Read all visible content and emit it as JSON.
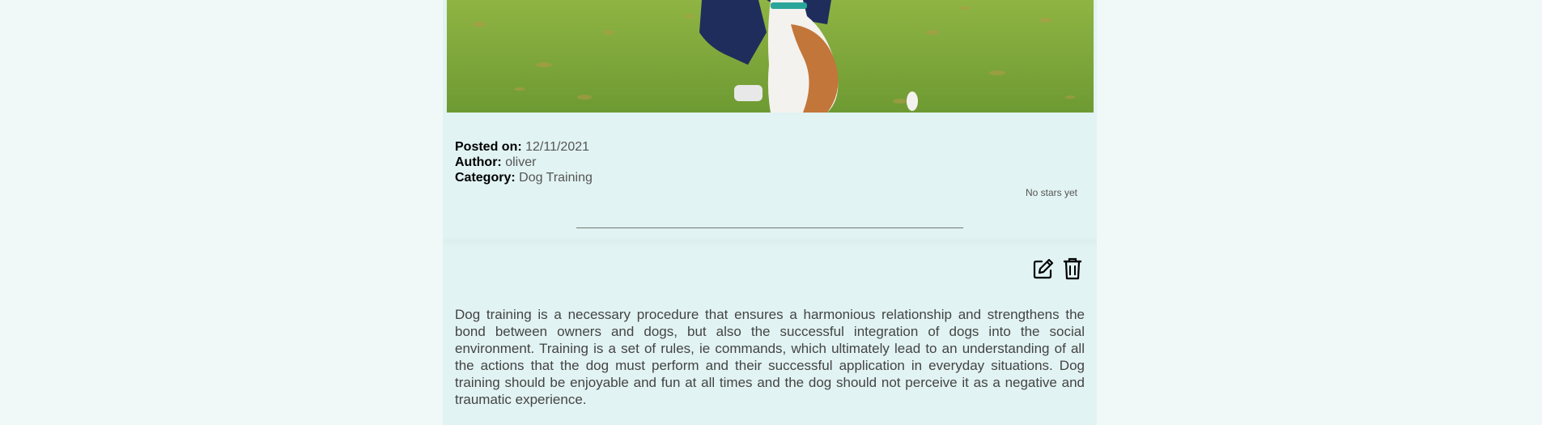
{
  "post": {
    "hero_alt": "Person kneeling on grass with a brown and white dog",
    "posted_on_label": "Posted on:",
    "posted_on_value": "12/11/2021",
    "author_label": "Author:",
    "author_value": "oliver",
    "category_label": "Category:",
    "category_value": "Dog Training",
    "rating_text": "No stars yet",
    "body": "Dog training is a necessary procedure that ensures a harmonious relationship and strengthens the bond between owners and dogs, but also the successful integration of dogs into the social environment. Training is a set of rules, ie commands, which ultimately lead to an understanding of all the actions that the dog must perform and their successful application in everyday situations. Dog training should be enjoyable and fun at all times and the dog should not perceive it as a negative and traumatic experience."
  },
  "actions": {
    "edit_icon": "edit-icon",
    "delete_icon": "trash-icon"
  },
  "colors": {
    "page_bg": "#f0f9f8",
    "card_bg": "#e1f3f2",
    "text": "#444444"
  }
}
